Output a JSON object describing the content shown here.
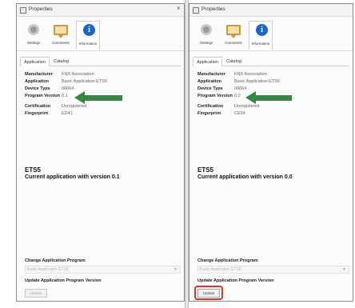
{
  "left": {
    "title": "Properties",
    "close": "x",
    "icon_tabs": [
      {
        "label": "Settings",
        "icon": "gear-icon"
      },
      {
        "label": "Comments",
        "icon": "comment-icon"
      },
      {
        "label": "Information",
        "icon": "info-icon"
      }
    ],
    "sub_tabs": [
      "Application",
      "Catalog"
    ],
    "props": [
      {
        "key": "Manufacturer",
        "value": "KNX Association"
      },
      {
        "key": "Application",
        "value": "Basic Application ETS5"
      },
      {
        "key": "Device Type",
        "value": "00064"
      },
      {
        "key": "Program Version",
        "value": "0.1"
      },
      {
        "key": "Certification",
        "value": "Unregistered"
      },
      {
        "key": "Fingerprint",
        "value": "ED41"
      }
    ],
    "heading": "ETS5",
    "subheading": "Current application with version 0.1",
    "change_label": "Change Application Program",
    "change_value": "Basic Application ETS5",
    "update_label": "Update Application Program Version",
    "update_button": "Update"
  },
  "right": {
    "title": "Properties",
    "icon_tabs": [
      {
        "label": "Settings",
        "icon": "gear-icon"
      },
      {
        "label": "Comments",
        "icon": "comment-icon"
      },
      {
        "label": "Information",
        "icon": "info-icon"
      }
    ],
    "sub_tabs": [
      "Application",
      "Catalog"
    ],
    "props": [
      {
        "key": "Manufacturer",
        "value": "KNX Association"
      },
      {
        "key": "Application",
        "value": "Basic Application ETS5"
      },
      {
        "key": "Device Type",
        "value": "00064"
      },
      {
        "key": "Program Version",
        "value": "0.0"
      },
      {
        "key": "Certification",
        "value": "Unregistered"
      },
      {
        "key": "Fingerprint",
        "value": "CE04"
      }
    ],
    "heading": "ETS5",
    "subheading": "Current application with version 0.0",
    "change_label": "Change Application Program",
    "change_value": "Basic Application ETS5",
    "update_label": "Update Application Program Version",
    "update_button": "Update"
  },
  "colors": {
    "arrow": "#2f8a3f",
    "highlight": "#d9342b",
    "info_icon": "#1f64c8"
  }
}
